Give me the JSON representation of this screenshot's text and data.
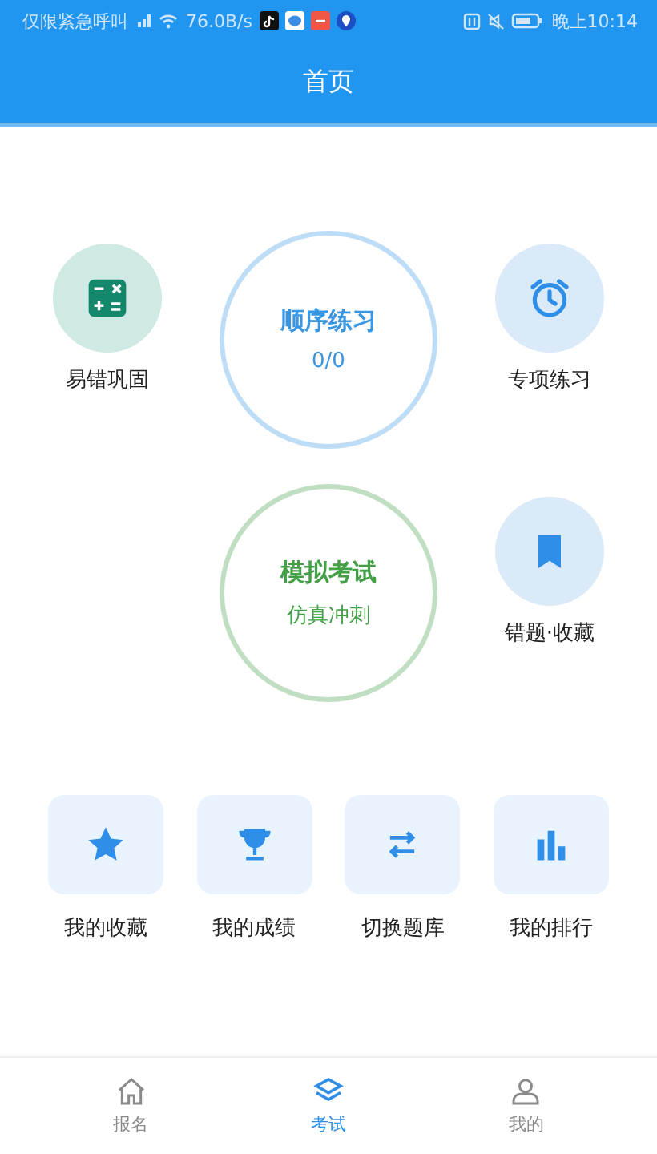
{
  "status_bar": {
    "carrier": "仅限紧急呼叫",
    "speed": "76.0B/s",
    "time": "晚上10:14"
  },
  "header": {
    "title": "首页"
  },
  "main_circles": [
    {
      "title": "顺序练习",
      "subtitle": "0/0",
      "color": "#3a96e0"
    },
    {
      "title": "模拟考试",
      "subtitle": "仿真冲刺",
      "color": "#43a047"
    }
  ],
  "side_items": [
    {
      "label": "易错巩固",
      "color": "#cfe9e4"
    },
    {
      "label": "专项练习",
      "color": "#dbeaf8"
    },
    {
      "label": "错题·收藏",
      "color": "#dbeaf8"
    }
  ],
  "tools": [
    {
      "label": "我的收藏"
    },
    {
      "label": "我的成绩"
    },
    {
      "label": "切换题库"
    },
    {
      "label": "我的排行"
    }
  ],
  "tabs": [
    {
      "label": "报名",
      "selected": false
    },
    {
      "label": "考试",
      "selected": true
    },
    {
      "label": "我的",
      "selected": false
    }
  ]
}
